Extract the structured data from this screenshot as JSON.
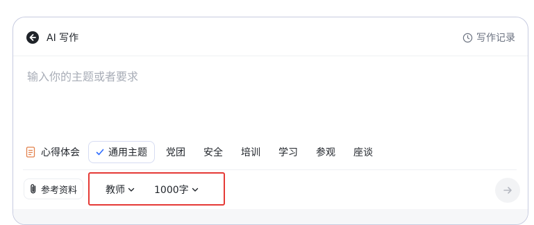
{
  "header": {
    "title": "AI 写作",
    "history_label": "写作记录"
  },
  "prompt": {
    "placeholder": "输入你的主题或者要求",
    "value": ""
  },
  "themes": {
    "label": "心得体会",
    "items": [
      {
        "label": "通用主题",
        "selected": true
      },
      {
        "label": "党团"
      },
      {
        "label": "安全"
      },
      {
        "label": "培训"
      },
      {
        "label": "学习"
      },
      {
        "label": "参观"
      },
      {
        "label": "座谈"
      }
    ]
  },
  "toolbar": {
    "reference_label": "参考资料",
    "role_select": "教师",
    "length_select": "1000字"
  },
  "colors": {
    "accent": "#3370ff",
    "highlight_border": "#e53935",
    "doc_icon": "#e2804b"
  },
  "icons": {
    "back": "arrow-left-circle-icon",
    "history": "clock-icon",
    "theme_label": "document-icon",
    "selected": "check-icon",
    "reference": "paperclip-icon",
    "dropdown": "chevron-down-icon",
    "send": "arrow-right-icon"
  }
}
